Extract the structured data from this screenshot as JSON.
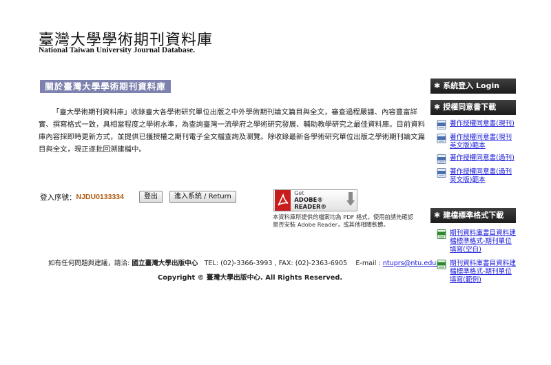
{
  "header": {
    "title_zh": "臺灣大學學術期刊資料庫",
    "title_en": "National Taiwan University Journal Database."
  },
  "about": {
    "heading": "關於臺灣大學學術期刊資料庫",
    "body": "「臺大學術期刊資料庫」收錄臺大各學術研究單位出版之中外學術期刊論文篇目與全文，審查過程嚴謹、內容豐富詳實、撰寫格式一致，具相當程度之學術水準，為查詢臺灣一流學府之學術研究發展、輔助教學研究之最佳資料庫。目前資料庫內容採即時更新方式，並提供已獲授權之期刊電子全文檔查詢及瀏覽。除收錄最新各學術研究單位出版之學術期刊論文篇目與全文，現正逐批回溯建檔中。"
  },
  "login": {
    "label": "登入序號：",
    "id": "NJDU0133334",
    "logout_label": "登出",
    "enter_label": "進入系統 / Return"
  },
  "adobe": {
    "get_label": "Get",
    "reader_label": "ADOBE® READER®",
    "note": "本資料庫所提供的檔案均為 PDF 格式，使用前請先確認是否安裝 Adobe Reader，或其他相關軟體。"
  },
  "footer": {
    "contact_prefix": "如有任何問題與建議，請洽: ",
    "publisher": "國立臺灣大學出版中心",
    "tel": "TEL: (02)-3366-3993 , FAX: (02)-2363-6905",
    "email_label": "E-mail : ",
    "email": "ntuprs@ntu.edu.tw",
    "copyright": "Copyright © 臺灣大學出版中心. All Rights Reserved."
  },
  "sidebar": {
    "login": {
      "star": "✱",
      "title": "系統登入 Login"
    },
    "agreement": {
      "star": "✱",
      "title": "授權同意書下載",
      "items": [
        {
          "label": "著作授權同意書(現刊)",
          "icon": "doc-icon"
        },
        {
          "label": "著作授權同意書(現刊英文版)範本",
          "icon": "doc-icon"
        },
        {
          "label": "著作授權同意書(過刊)",
          "icon": "doc-icon"
        },
        {
          "label": "著作授權同意書(過刊英文版)範本",
          "icon": "doc-icon"
        }
      ]
    },
    "format": {
      "star": "✱",
      "title": "建檔標準格式下載",
      "items": [
        {
          "label": "期刊資料庫書目資料建檔標準格式-期刊單位填寫(空白)",
          "icon": "xls-icon"
        },
        {
          "label": "期刊資料庫書目資料建檔標準格式-期刊單位填寫(範例)",
          "icon": "xls-icon"
        }
      ]
    }
  },
  "colors": {
    "heading_bg": "#7e82ae",
    "sidebar_bar": "#2a2a2a",
    "link": "#1a1ad8",
    "login_id": "#b05a10",
    "adobe_red": "#c81d1d"
  }
}
